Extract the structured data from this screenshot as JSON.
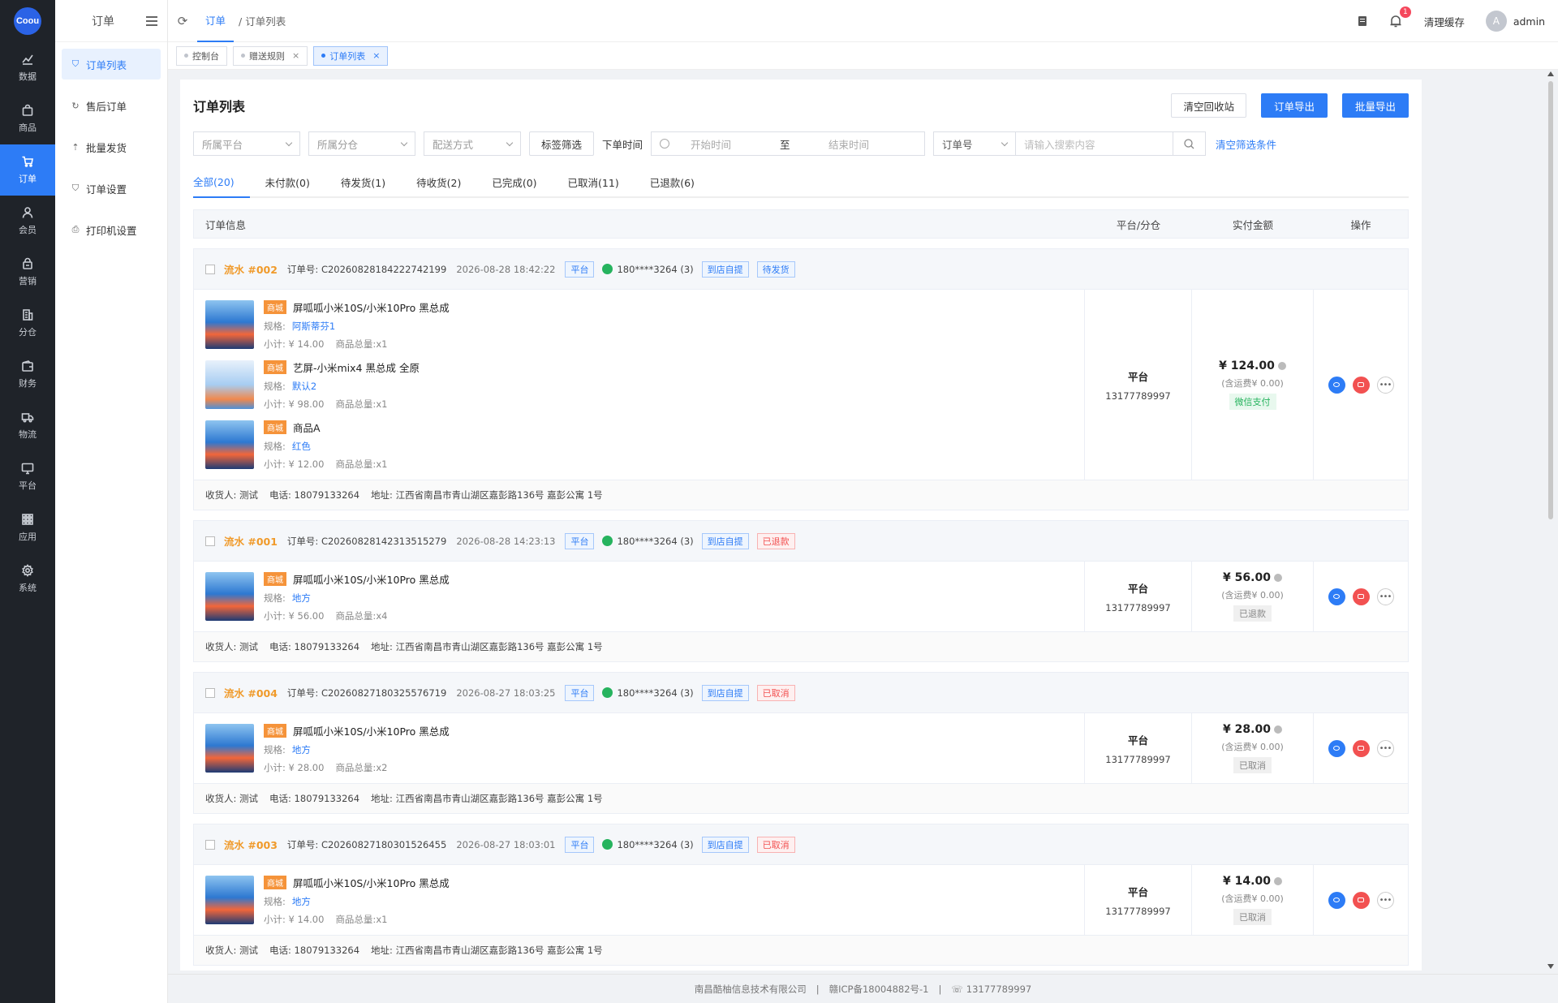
{
  "logo_text": "Coou",
  "rail": [
    {
      "label": "数据",
      "icon": "chart-icon"
    },
    {
      "label": "商品",
      "icon": "bag-icon"
    },
    {
      "label": "订单",
      "icon": "cart-icon",
      "active": true
    },
    {
      "label": "会员",
      "icon": "user-icon"
    },
    {
      "label": "营销",
      "icon": "gift-icon"
    },
    {
      "label": "分仓",
      "icon": "building-icon"
    },
    {
      "label": "财务",
      "icon": "wallet-icon"
    },
    {
      "label": "物流",
      "icon": "truck-icon"
    },
    {
      "label": "平台",
      "icon": "monitor-icon"
    },
    {
      "label": "应用",
      "icon": "grid-icon"
    },
    {
      "label": "系统",
      "icon": "gear-icon"
    }
  ],
  "subside": {
    "title": "订单",
    "items": [
      {
        "label": "订单列表",
        "icon": "cart-icon"
      },
      {
        "label": "售后订单",
        "icon": "refresh-icon"
      },
      {
        "label": "批量发货",
        "icon": "upload-icon"
      },
      {
        "label": "订单设置",
        "icon": "cart-settings-icon"
      },
      {
        "label": "打印机设置",
        "icon": "printer-icon"
      }
    ]
  },
  "topbar": {
    "crumb_active": "订单",
    "crumb_rest": "/ 订单列表",
    "notification_count": "1",
    "clear_cache": "清理缓存",
    "avatar_letter": "A",
    "username": "admin"
  },
  "tabs": [
    {
      "label": "控制台",
      "closable": false
    },
    {
      "label": "赠送规则",
      "closable": true
    },
    {
      "label": "订单列表",
      "closable": true,
      "active": true
    }
  ],
  "panel": {
    "title": "订单列表",
    "btn_clear_recycle": "清空回收站",
    "btn_export": "订单导出",
    "btn_batch_export": "批量导出"
  },
  "filters": {
    "platform": "所属平台",
    "warehouse": "所属分仓",
    "delivery": "配送方式",
    "tag_filter": "标签筛选",
    "order_time_label": "下单时间",
    "start_time": "开始时间",
    "to": "至",
    "end_time": "结束时间",
    "search_field": "订单号",
    "search_placeholder": "请输入搜索内容",
    "clear_filters": "清空筛选条件"
  },
  "status_tabs": [
    "全部(20)",
    "未付款(0)",
    "待发货(1)",
    "待收货(2)",
    "已完成(0)",
    "已取消(11)",
    "已退款(6)"
  ],
  "table_headers": {
    "info": "订单信息",
    "platform": "平台/分仓",
    "amount": "实付金额",
    "ops": "操作"
  },
  "labels": {
    "order_no_prefix": "订单号: ",
    "spec": "规格:",
    "subtotal_prefix": "小计: ",
    "qty_prefix": "商品总量:",
    "mall": "商城",
    "freight_prefix": "(含运费¥ ",
    "receiver": "收货人: 测试",
    "tel": "电话: 18079133264",
    "address": "地址: 江西省南昌市青山湖区嘉彭路136号 嘉彭公寓 1号"
  },
  "orders": [
    {
      "serial": "流水 #002",
      "order_no": "C20260828184222742199",
      "time": "2026-08-28 18:42:22",
      "platform_tag": "平台",
      "buyer": "180****3264 (3)",
      "delivery_tag": "到店自提",
      "status_tag": "待发货",
      "status_color": "blue",
      "items": [
        {
          "title": "屏呱呱小米10S/小米10Pro 黑总成",
          "spec": "阿斯蒂芬1",
          "subtotal": "¥ 14.00",
          "qty": "x1"
        },
        {
          "title": "艺屏-小米mix4 黑总成 全原",
          "spec": "默认2",
          "subtotal": "¥ 98.00",
          "qty": "x1",
          "alt": true
        },
        {
          "title": "商品A",
          "spec": "红色",
          "subtotal": "¥ 12.00",
          "qty": "x1"
        }
      ],
      "platform": "平台",
      "platform_phone": "13177789997",
      "amount": "¥ 124.00",
      "freight": "0.00",
      "pay_tag": "微信支付",
      "pay_color": "green"
    },
    {
      "serial": "流水 #001",
      "order_no": "C20260828142313515279",
      "time": "2026-08-28 14:23:13",
      "platform_tag": "平台",
      "buyer": "180****3264 (3)",
      "delivery_tag": "到店自提",
      "status_tag": "已退款",
      "status_color": "red",
      "items": [
        {
          "title": "屏呱呱小米10S/小米10Pro 黑总成",
          "spec": "地方",
          "subtotal": "¥ 56.00",
          "qty": "x4"
        }
      ],
      "platform": "平台",
      "platform_phone": "13177789997",
      "amount": "¥ 56.00",
      "freight": "0.00",
      "pay_tag": "已退款",
      "pay_color": "gray"
    },
    {
      "serial": "流水 #004",
      "order_no": "C20260827180325576719",
      "time": "2026-08-27 18:03:25",
      "platform_tag": "平台",
      "buyer": "180****3264 (3)",
      "delivery_tag": "到店自提",
      "status_tag": "已取消",
      "status_color": "red",
      "items": [
        {
          "title": "屏呱呱小米10S/小米10Pro 黑总成",
          "spec": "地方",
          "subtotal": "¥ 28.00",
          "qty": "x2"
        }
      ],
      "platform": "平台",
      "platform_phone": "13177789997",
      "amount": "¥ 28.00",
      "freight": "0.00",
      "pay_tag": "已取消",
      "pay_color": "gray"
    },
    {
      "serial": "流水 #003",
      "order_no": "C20260827180301526455",
      "time": "2026-08-27 18:03:01",
      "platform_tag": "平台",
      "buyer": "180****3264 (3)",
      "delivery_tag": "到店自提",
      "status_tag": "已取消",
      "status_color": "red",
      "items": [
        {
          "title": "屏呱呱小米10S/小米10Pro 黑总成",
          "spec": "地方",
          "subtotal": "¥ 14.00",
          "qty": "x1"
        }
      ],
      "platform": "平台",
      "platform_phone": "13177789997",
      "amount": "¥ 14.00",
      "freight": "0.00",
      "pay_tag": "已取消",
      "pay_color": "gray"
    }
  ],
  "footer": {
    "company": "南昌酷柚信息技术有限公司",
    "icp": "赣ICP备18004882号-1",
    "phone": "13177789997"
  }
}
